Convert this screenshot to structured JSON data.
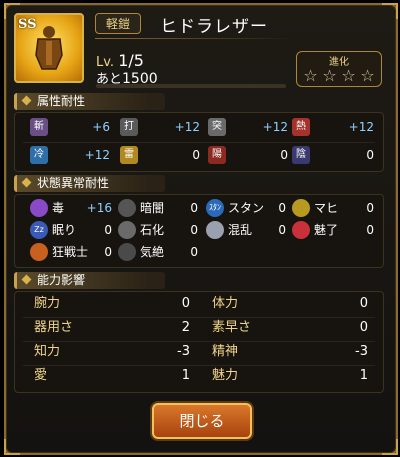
{
  "header": {
    "rank": "SS",
    "category": "軽鎧",
    "name": "ヒドラレザー",
    "level_label": "Lv.",
    "level": "1/5",
    "remain_label": "あと",
    "remain_value": "1500",
    "exp_progress": 0,
    "evolution_label": "進化",
    "stars": "☆☆☆☆",
    "star_count_total": 4,
    "star_count_filled": 0
  },
  "sections": {
    "element_resist": "属性耐性",
    "status_resist": "状態異常耐性",
    "ability_effect": "能力影響"
  },
  "element_resist": [
    {
      "icon": "斬",
      "value": "+6",
      "color": "#6a4e86"
    },
    {
      "icon": "打",
      "value": "+12",
      "color": "#5a5a5a"
    },
    {
      "icon": "突",
      "value": "+12",
      "color": "#6a6a6a"
    },
    {
      "icon": "熱",
      "value": "+12",
      "color": "#a5332c"
    },
    {
      "icon": "冷",
      "value": "+12",
      "color": "#2f6fa8"
    },
    {
      "icon": "雷",
      "value": "0",
      "color": "#b08a20"
    },
    {
      "icon": "陽",
      "value": "0",
      "color": "#8a2a20"
    },
    {
      "icon": "陰",
      "value": "0",
      "color": "#3a3a70"
    }
  ],
  "status_resist": [
    {
      "icon": "poison-icon",
      "label": "毒",
      "value": "+16",
      "color": "#8a4ac8"
    },
    {
      "icon": "darkness-icon",
      "label": "暗闇",
      "value": "0",
      "color": "#555"
    },
    {
      "icon": "stun-icon",
      "label": "スタン",
      "value": "0",
      "color": "#2a6ab8",
      "badge": "ｽﾀﾝ"
    },
    {
      "icon": "paralysis-icon",
      "label": "マヒ",
      "value": "0",
      "color": "#b89a20"
    },
    {
      "icon": "sleep-icon",
      "label": "眠り",
      "value": "0",
      "color": "#3a5ab8",
      "badge": "Zz"
    },
    {
      "icon": "petrify-icon",
      "label": "石化",
      "value": "0",
      "color": "#6a6a6a"
    },
    {
      "icon": "confusion-icon",
      "label": "混乱",
      "value": "0",
      "color": "#9aa0b0"
    },
    {
      "icon": "charm-icon",
      "label": "魅了",
      "value": "0",
      "color": "#c8303a"
    },
    {
      "icon": "berserk-icon",
      "label": "狂戦士",
      "value": "0",
      "color": "#c86020"
    },
    {
      "icon": "faint-icon",
      "label": "気絶",
      "value": "0",
      "color": "#4a4a4a"
    }
  ],
  "stats": [
    {
      "label": "腕力",
      "value": "0"
    },
    {
      "label": "体力",
      "value": "0"
    },
    {
      "label": "器用さ",
      "value": "2"
    },
    {
      "label": "素早さ",
      "value": "0"
    },
    {
      "label": "知力",
      "value": "-3"
    },
    {
      "label": "精神",
      "value": "-3"
    },
    {
      "label": "愛",
      "value": "1"
    },
    {
      "label": "魅力",
      "value": "1"
    }
  ],
  "close_label": "閉じる",
  "colors": {
    "gold": "#c9a24a",
    "positive": "#8fd0ff",
    "button": "#c4601c"
  }
}
